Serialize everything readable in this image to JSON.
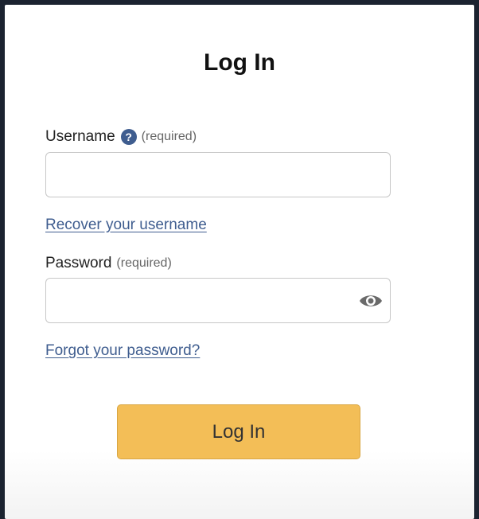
{
  "form": {
    "title": "Log In",
    "username": {
      "label": "Username",
      "required_hint": "(required)",
      "value": "",
      "help_icon": "question-circle-icon"
    },
    "recover_username_link": "Recover your username",
    "password": {
      "label": "Password",
      "required_hint": "(required)",
      "value": "",
      "show_icon": "eye-icon"
    },
    "forgot_password_link": "Forgot your password?",
    "submit_label": "Log In"
  },
  "colors": {
    "accent_link": "#3f5d8f",
    "button_fill": "#f3be57",
    "help_icon": "#3f5d8f"
  }
}
